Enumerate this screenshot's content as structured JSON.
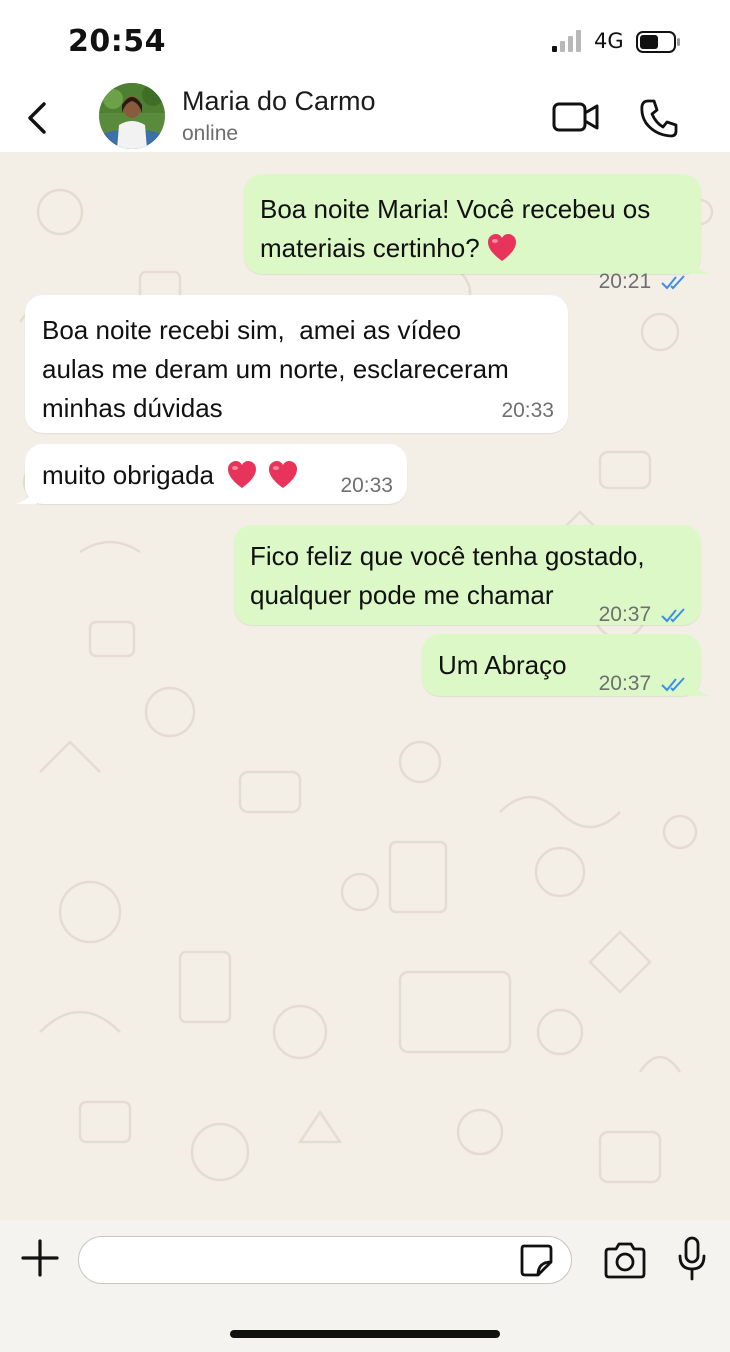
{
  "status_bar": {
    "time": "20:54",
    "network": "4G",
    "icons": [
      "signal-icon",
      "battery-icon"
    ]
  },
  "header": {
    "contact_name": "Maria do Carmo",
    "contact_status": "online",
    "icons": [
      "back-arrow-icon",
      "video-camera-icon",
      "phone-icon"
    ]
  },
  "messages": [
    {
      "direction": "outgoing",
      "lines": [
        "Boa noite Maria! Você recebeu os",
        "materiais certinho?"
      ],
      "emoji": "red-heart",
      "time": "20:21",
      "read": true
    },
    {
      "direction": "incoming",
      "lines": [
        "Boa noite recebi sim,  amei as vídeo",
        "aulas me deram um norte, esclareceram",
        "minhas dúvidas"
      ],
      "time": "20:33"
    },
    {
      "direction": "incoming",
      "lines": [
        "muito obrigada"
      ],
      "emoji": "red-heart x2",
      "time": "20:33"
    },
    {
      "direction": "outgoing",
      "lines": [
        "Fico feliz que você tenha gostado,",
        "qualquer pode me chamar"
      ],
      "time": "20:37",
      "read": true
    },
    {
      "direction": "outgoing",
      "lines": [
        "Um Abraço"
      ],
      "time": "20:37",
      "read": true
    }
  ],
  "composer": {
    "input_value": "",
    "icons": [
      "plus-icon",
      "sticker-icon",
      "camera-icon",
      "microphone-icon"
    ]
  },
  "colors": {
    "outgoing_bubble": "#dcf8c6",
    "incoming_bubble": "#ffffff",
    "read_ticks": "#3b8fe6",
    "chat_background": "#f3efe7",
    "heart": "#e8345a"
  }
}
